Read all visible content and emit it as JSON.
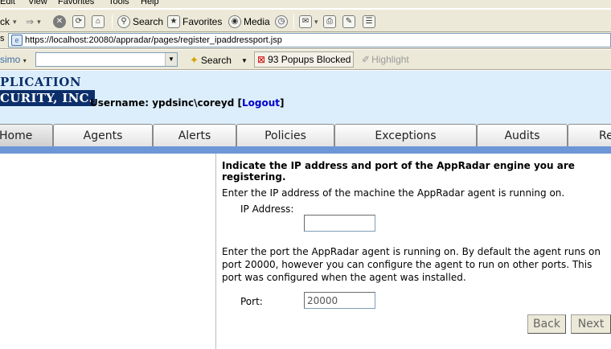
{
  "menu": [
    "Edit",
    "View",
    "Favorites",
    "Tools",
    "Help"
  ],
  "toolbar": {
    "back_label": "ck",
    "search_label": "Search",
    "favorites_label": "Favorites",
    "media_label": "Media"
  },
  "address": {
    "url": "https://localhost:20080/appradar/pages/register_ipaddressport.jsp"
  },
  "searchbar": {
    "brand": "simo",
    "search_label": "Search",
    "popups_label": "93 Popups Blocked",
    "highlight_label": "Highlight"
  },
  "header": {
    "logo_line1": "PLICATION",
    "logo_line2": "CURITY, INC.",
    "username_label": "Username: ypdsinc\\coreyd [",
    "logout_label": "Logout",
    "username_suffix": "]"
  },
  "tabs": [
    "Home",
    "Agents",
    "Alerts",
    "Policies",
    "Exceptions",
    "Audits",
    "Re"
  ],
  "form": {
    "heading": "Indicate the IP address and port of the AppRadar engine you are registering.",
    "ip_instruction": "Enter the IP address of the machine the AppRadar agent is running on.",
    "ip_label": "IP Address:",
    "ip_value": "",
    "port_instruction": "Enter the port the AppRadar agent is running on. By default the agent runs on port 20000, however you can configure the agent to run on other ports. This port was configured when the agent was installed.",
    "port_label": "Port:",
    "port_value": "20000",
    "back_button": "Back",
    "next_button": "Next"
  }
}
